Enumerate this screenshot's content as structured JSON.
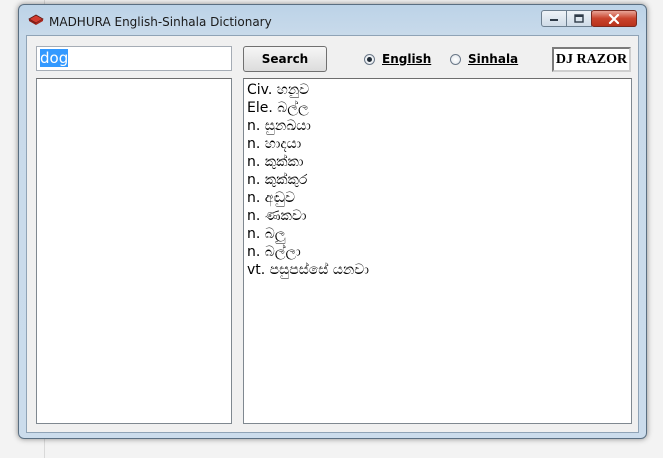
{
  "window": {
    "title": "MADHURA English-Sinhala Dictionary"
  },
  "search": {
    "value": "dog",
    "button_label": "Search"
  },
  "language": {
    "english_label": "English",
    "sinhala_label": "Sinhala",
    "selected": "English"
  },
  "brand": {
    "label": "DJ RAZOR"
  },
  "results": [
    "Civ. හනුව",
    "Ele. බල්ල",
    "n. සුනඛයා",
    "n. හාදයා",
    "n. කුක්කා",
    "n. කුක්කුර",
    "n. අඬුව",
    "n. ණකවා",
    "n. බලු",
    "n. බල්ලා",
    "vt. පසුපස්සේ යනවා"
  ],
  "colors": {
    "selection": "#3399ff",
    "close_button": "#c9432c",
    "titlebar": "#bcd3e8"
  }
}
